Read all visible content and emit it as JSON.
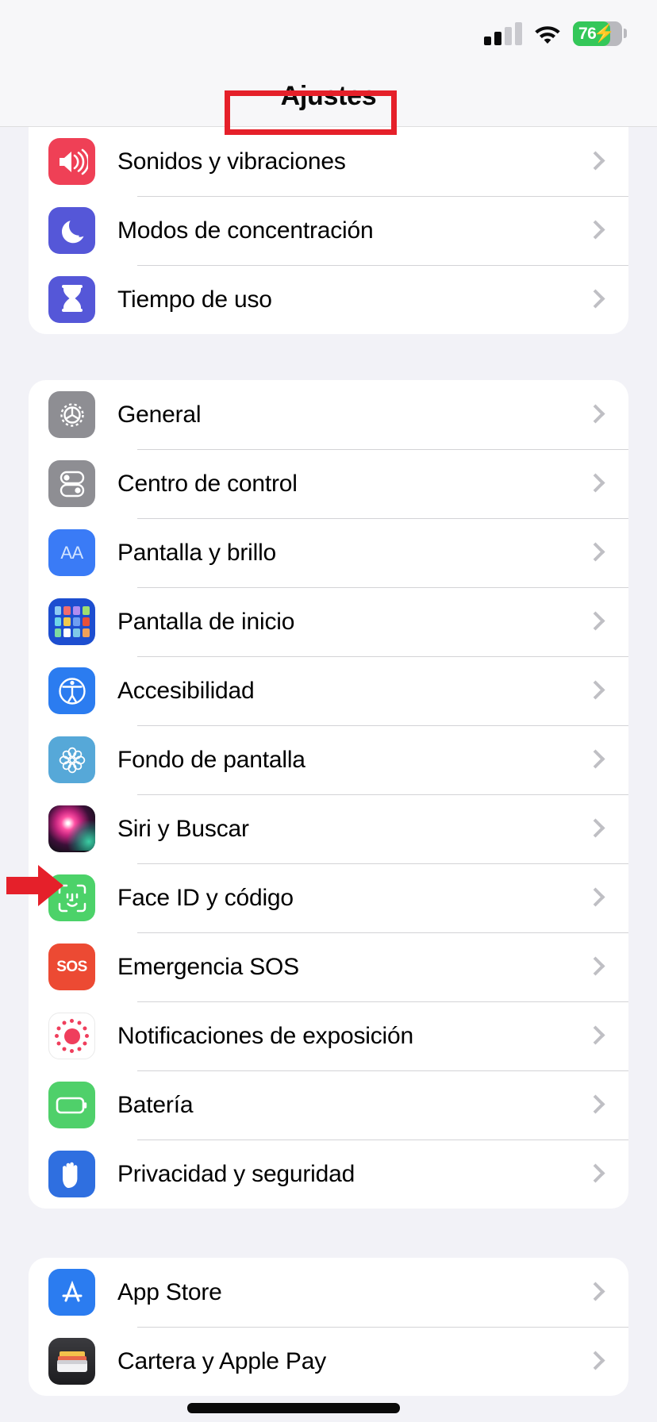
{
  "status_bar": {
    "cellular_bars_filled": 2,
    "cellular_bars_total": 4,
    "wifi_icon": "wifi-icon",
    "battery_percent": "76",
    "battery_charging": true,
    "battery_color": "#34c759"
  },
  "header": {
    "title": "Ajustes",
    "annotation": {
      "type": "rectangle",
      "color": "#e5202a",
      "target": "Ajustes"
    }
  },
  "annotations": {
    "arrow": {
      "color": "#e5202a",
      "points_to": "Siri y Buscar",
      "direction": "right"
    },
    "redaction": {
      "color": "#0a0a0a",
      "covers": "Cartera y Apple Pay"
    }
  },
  "groups": [
    {
      "id": "group-sounds",
      "rows": [
        {
          "label": "Sonidos y vibraciones",
          "icon": "speaker-waves-icon",
          "icon_class": "ico-sound",
          "color": "#ef4056"
        },
        {
          "label": "Modos de concentración",
          "icon": "moon-icon",
          "icon_class": "ico-focus",
          "color": "#5557d8"
        },
        {
          "label": "Tiempo de uso",
          "icon": "hourglass-icon",
          "icon_class": "ico-screentime",
          "color": "#5557d8"
        }
      ]
    },
    {
      "id": "group-system",
      "rows": [
        {
          "label": "General",
          "icon": "gear-icon",
          "icon_class": "ico-general",
          "color": "#8e8e93"
        },
        {
          "label": "Centro de control",
          "icon": "toggles-icon",
          "icon_class": "ico-ctrl",
          "color": "#8e8e93"
        },
        {
          "label": "Pantalla y brillo",
          "icon": "aa-text-size-icon",
          "icon_class": "ico-display",
          "color": "#3a7bf6",
          "glyph": "AA"
        },
        {
          "label": "Pantalla de inicio",
          "icon": "app-grid-icon",
          "icon_class": "ico-home",
          "color": "#1d4ed0"
        },
        {
          "label": "Accesibilidad",
          "icon": "accessibility-person-icon",
          "icon_class": "ico-access",
          "color": "#2b7cf0"
        },
        {
          "label": "Fondo de pantalla",
          "icon": "flower-wallpaper-icon",
          "icon_class": "ico-wall",
          "color": "#56a8d8"
        },
        {
          "label": "Siri y Buscar",
          "icon": "siri-orb-icon",
          "icon_class": "ico-siri",
          "color": "#c0247c"
        },
        {
          "label": "Face ID y código",
          "icon": "face-id-icon",
          "icon_class": "ico-faceid",
          "color": "#4cd269"
        },
        {
          "label": "Emergencia SOS",
          "icon": "sos-icon",
          "icon_class": "ico-sos",
          "color": "#ec4a33",
          "glyph": "SOS"
        },
        {
          "label": "Notificaciones de exposición",
          "icon": "exposure-dots-icon",
          "icon_class": "ico-expos",
          "color": "#ef3e5c"
        },
        {
          "label": "Batería",
          "icon": "battery-icon",
          "icon_class": "ico-batt",
          "color": "#4fd06a"
        },
        {
          "label": "Privacidad y seguridad",
          "icon": "hand-privacy-icon",
          "icon_class": "ico-priv",
          "color": "#2f6fe0"
        }
      ]
    },
    {
      "id": "group-store",
      "rows": [
        {
          "label": "App Store",
          "icon": "app-store-icon",
          "icon_class": "ico-appstore",
          "color": "#2b7cf0"
        },
        {
          "label": "Cartera y Apple Pay",
          "icon": "wallet-icon",
          "icon_class": "ico-wallet",
          "color": "#2b2b2e"
        }
      ]
    }
  ],
  "chevron_icon": "chevron-right-icon"
}
